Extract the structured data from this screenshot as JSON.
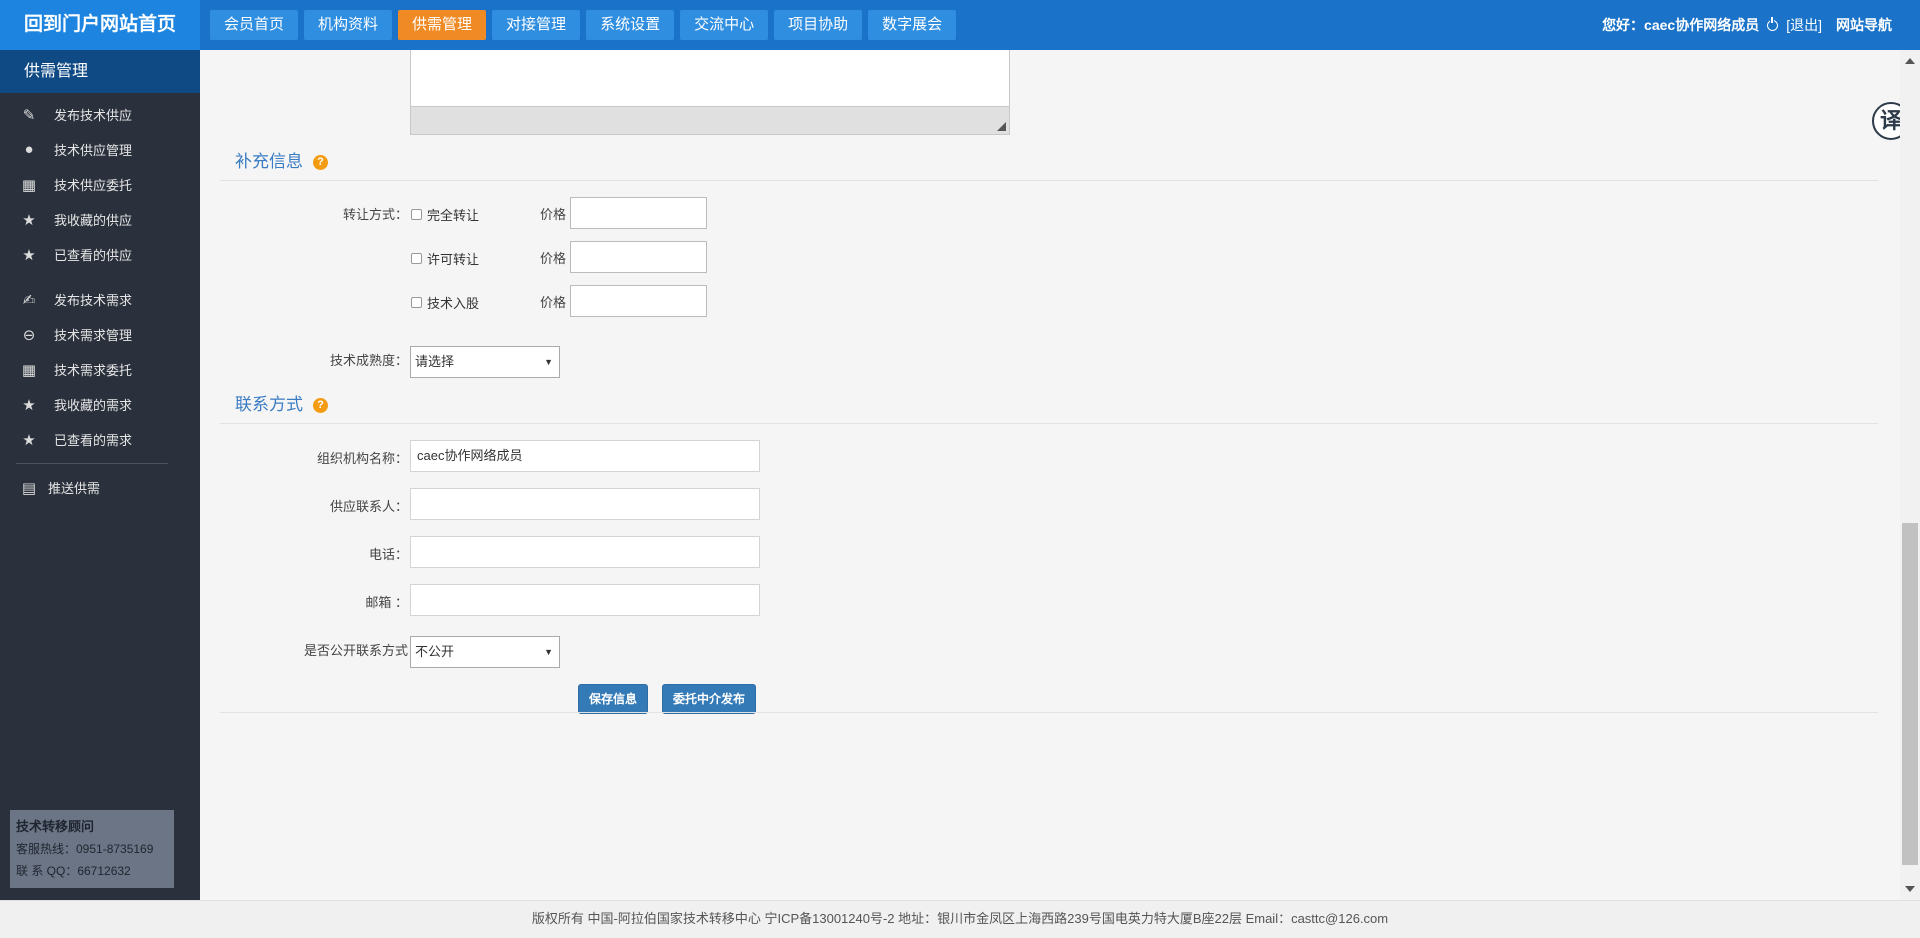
{
  "header": {
    "portal_label": "回到门户网站首页",
    "nav": [
      {
        "label": "会员首页"
      },
      {
        "label": "机构资料"
      },
      {
        "label": "供需管理",
        "active": true
      },
      {
        "label": "对接管理"
      },
      {
        "label": "系统设置"
      },
      {
        "label": "交流中心"
      },
      {
        "label": "项目协助"
      },
      {
        "label": "数字展会"
      }
    ],
    "greeting": "您好：caec协作网络成员",
    "logout": "[退出]",
    "site_nav": "网站导航"
  },
  "sidebar": {
    "title": "供需管理",
    "supply_items": [
      {
        "label": "发布技术供应",
        "icon": "edit-pen-icon"
      },
      {
        "label": "技术供应管理",
        "icon": "supply-badge-icon"
      },
      {
        "label": "技术供应委托",
        "icon": "grid-icon"
      },
      {
        "label": "我收藏的供应",
        "icon": "star-icon"
      },
      {
        "label": "已查看的供应",
        "icon": "star-icon"
      }
    ],
    "demand_items": [
      {
        "label": "发布技术需求",
        "icon": "edit-square-icon"
      },
      {
        "label": "技术需求管理",
        "icon": "demand-badge-icon"
      },
      {
        "label": "技术需求委托",
        "icon": "grid-icon"
      },
      {
        "label": "我收藏的需求",
        "icon": "star-icon"
      },
      {
        "label": "已查看的需求",
        "icon": "star-icon"
      }
    ],
    "push_item": {
      "label": "推送供需",
      "icon": "chart-board-icon"
    },
    "consultant": {
      "title": "技术转移顾问",
      "hotline": "客服热线：0951-8735169",
      "qq": "联 系 QQ：66712632"
    }
  },
  "supplement": {
    "title": "补充信息",
    "transfer_label": "转让方式：",
    "options": [
      {
        "label": "完全转让",
        "price_label": "价格",
        "checked": false,
        "price": ""
      },
      {
        "label": "许可转让",
        "price_label": "价格",
        "checked": false,
        "price": ""
      },
      {
        "label": "技术入股",
        "price_label": "价格",
        "checked": false,
        "price": ""
      }
    ],
    "maturity_label": "技术成熟度：",
    "maturity_value": "请选择"
  },
  "contact": {
    "title": "联系方式",
    "org_label": "组织机构名称：",
    "org_value": "caec协作网络成员",
    "person_label": "供应联系人：",
    "person_value": "",
    "phone_label": "电话：",
    "phone_value": "",
    "email_label": "邮箱 ：",
    "email_value": "",
    "public_label": "是否公开联系方式",
    "public_value": "不公开"
  },
  "actions": {
    "save": "保存信息",
    "delegate": "委托中介发布"
  },
  "translate_label": "译",
  "footer": "版权所有 中国-阿拉伯国家技术转移中心 宁ICP备13001240号-2    地址：银川市金凤区上海西路239号国电英力特大厦B座22层 Email：casttc@126.com"
}
